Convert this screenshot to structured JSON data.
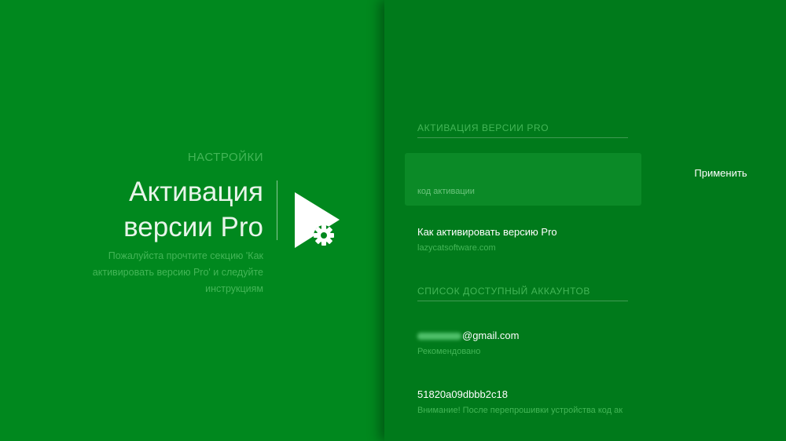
{
  "left": {
    "breadcrumb": "НАСТРОЙКИ",
    "title_line1": "Активация",
    "title_line2": "версии Pro",
    "description": "Пожалуйста прочтите секцию 'Как активировать версию Pro' и следуйте инструкциям",
    "logo_icon": "play-gear-icon"
  },
  "activation": {
    "section_title": "АКТИВАЦИЯ ВЕРСИИ PRO",
    "code_placeholder": "код активации",
    "apply_label": "Применить",
    "howto_title": "Как активировать версию Pro",
    "howto_url": "lazycatsoftware.com"
  },
  "accounts": {
    "section_title": "СПИСОК ДОСТУПНЫЙ АККАУНТОВ",
    "items": [
      {
        "title_suffix": "@gmail.com",
        "subtitle": "Рекомендовано"
      },
      {
        "title": "51820a09dbbb2c18",
        "subtitle": "Внимание! После перепрошивки устройства код ак"
      }
    ]
  },
  "colors": {
    "left_bg": "#00881e",
    "right_bg": "#007a1b",
    "accent_text": "#43b657",
    "input_bg": "#0b8a27"
  }
}
